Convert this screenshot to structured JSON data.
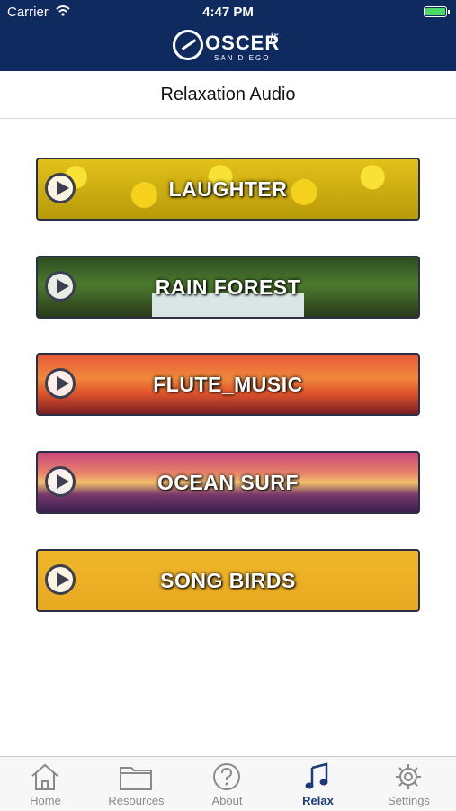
{
  "status": {
    "carrier": "Carrier",
    "time": "4:47 PM",
    "battery_level": 1.0
  },
  "brand": {
    "name": "OSCER",
    "suffix": "jr",
    "tagline": "SAN DIEGO"
  },
  "header": {
    "title": "Relaxation Audio"
  },
  "tracks": [
    {
      "label": "LAUGHTER"
    },
    {
      "label": "RAIN FOREST"
    },
    {
      "label": "FLUTE_MUSIC"
    },
    {
      "label": "OCEAN SURF"
    },
    {
      "label": "SONG BIRDS"
    }
  ],
  "tabs": [
    {
      "label": "Home",
      "icon": "home-icon"
    },
    {
      "label": "Resources",
      "icon": "folder-icon"
    },
    {
      "label": "About",
      "icon": "question-icon"
    },
    {
      "label": "Relax",
      "icon": "music-note-icon",
      "active": true
    },
    {
      "label": "Settings",
      "icon": "gear-icon"
    }
  ],
  "colors": {
    "brand": "#0f2a5f",
    "active_tab": "#1a3a7a",
    "inactive_tab": "#8a8a8a",
    "battery": "#4cd964"
  }
}
